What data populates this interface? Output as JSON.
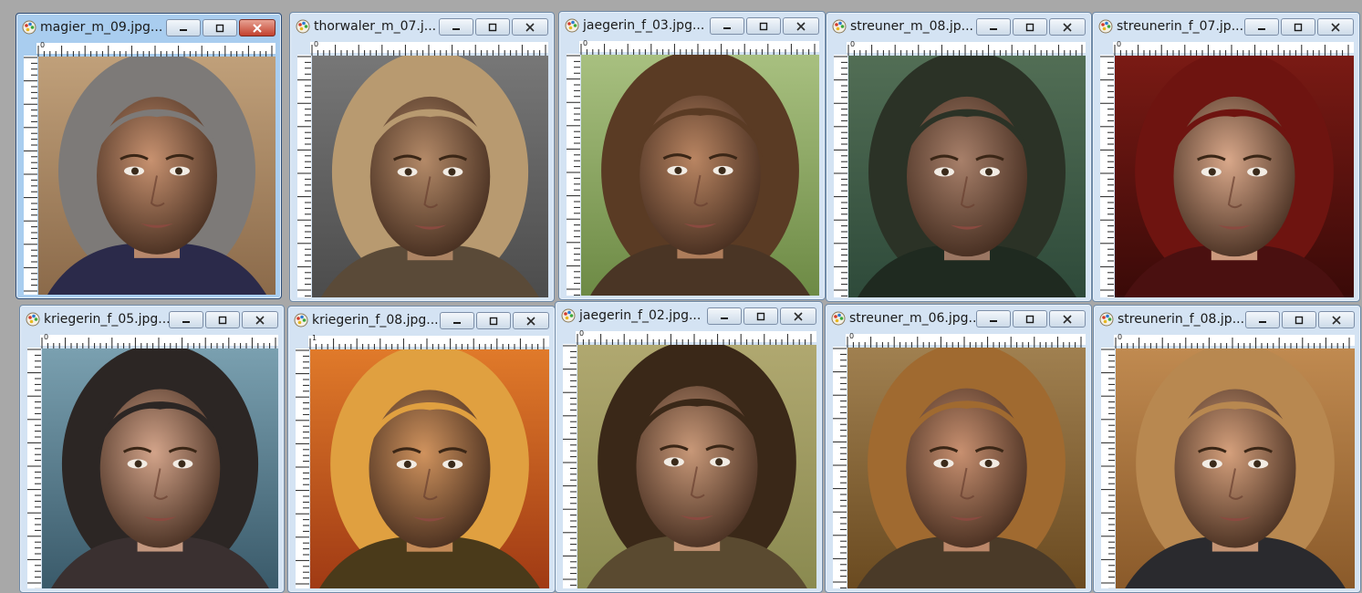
{
  "windows": [
    {
      "title": "magier_m_09.jpg...",
      "active": true,
      "ruler_start": "0",
      "portrait": {
        "skin": "#c89270",
        "hair": "#7d7a78",
        "bg1": "#8b6a4a",
        "bg2": "#c0a07a",
        "cloth": "#2b2a4a"
      }
    },
    {
      "title": "thorwaler_m_07.j...",
      "active": false,
      "ruler_start": "0",
      "portrait": {
        "skin": "#b48a68",
        "hair": "#b89a70",
        "bg1": "#4c4c4c",
        "bg2": "#777777",
        "cloth": "#5a4a38"
      }
    },
    {
      "title": "jaegerin_f_03.jpg...",
      "active": false,
      "ruler_start": "0",
      "portrait": {
        "skin": "#b98562",
        "hair": "#5a3b24",
        "bg1": "#6d8a45",
        "bg2": "#a8c080",
        "cloth": "#4a3525"
      }
    },
    {
      "title": "streuner_m_08.jp...",
      "active": false,
      "ruler_start": "0",
      "portrait": {
        "skin": "#a8806a",
        "hair": "#2b3226",
        "bg1": "#2e4a3a",
        "bg2": "#526e55",
        "cloth": "#1f2a20"
      }
    },
    {
      "title": "streunerin_f_07.jp...",
      "active": false,
      "ruler_start": "0",
      "portrait": {
        "skin": "#d9a88a",
        "hair": "#6e1410",
        "bg1": "#3a0a08",
        "bg2": "#7a1a14",
        "cloth": "#4a1010"
      }
    },
    {
      "title": "kriegerin_f_05.jpg...",
      "active": false,
      "ruler_start": "0",
      "portrait": {
        "skin": "#d3a48a",
        "hair": "#2c2624",
        "bg1": "#3a5a6a",
        "bg2": "#7aa0b0",
        "cloth": "#3a3030"
      }
    },
    {
      "title": "kriegerin_f_08.jpg...",
      "active": false,
      "ruler_start": "1",
      "portrait": {
        "skin": "#d0935e",
        "hair": "#e0a040",
        "bg1": "#a03a14",
        "bg2": "#e07a2a",
        "cloth": "#4a3a1a"
      }
    },
    {
      "title": "jaegerin_f_02.jpg...",
      "active": false,
      "ruler_start": "0",
      "portrait": {
        "skin": "#c89878",
        "hair": "#3a2818",
        "bg1": "#8a8a50",
        "bg2": "#b0a870",
        "cloth": "#5a4a30"
      }
    },
    {
      "title": "streuner_m_06.jpg...",
      "active": false,
      "ruler_start": "0",
      "portrait": {
        "skin": "#c89070",
        "hair": "#a06a30",
        "bg1": "#6a4a20",
        "bg2": "#a08050",
        "cloth": "#4a3a28"
      }
    },
    {
      "title": "streunerin_f_08.jp...",
      "active": false,
      "ruler_start": "0",
      "portrait": {
        "skin": "#d5a07c",
        "hair": "#b88850",
        "bg1": "#8a5a2a",
        "bg2": "#c08a50",
        "cloth": "#2a2a2e"
      }
    }
  ]
}
